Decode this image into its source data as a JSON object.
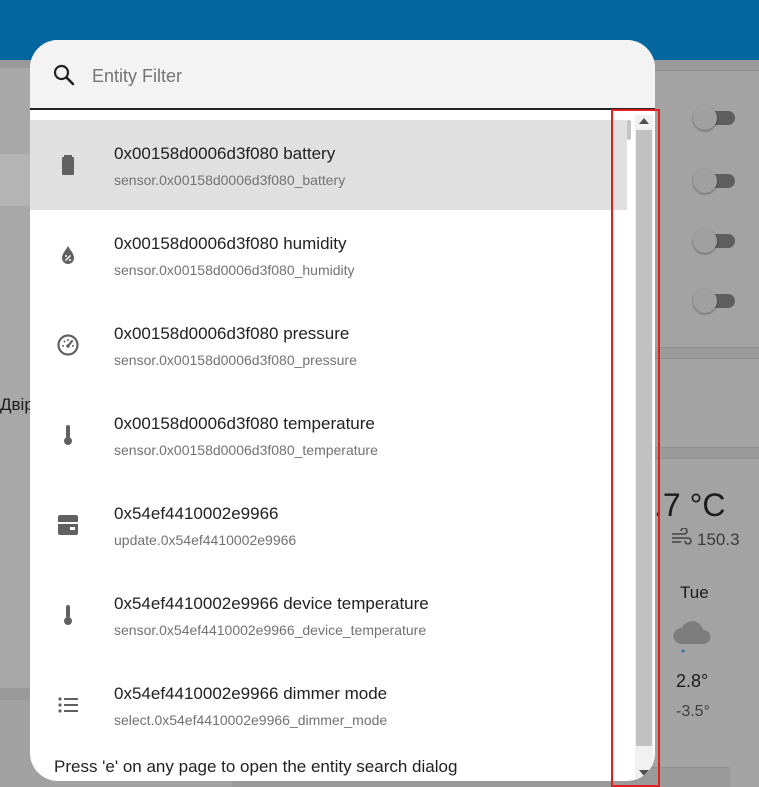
{
  "search": {
    "placeholder": "Entity Filter"
  },
  "entities": [
    {
      "name": "0x00158d0006d3f080 battery",
      "entity_id": "sensor.0x00158d0006d3f080_battery",
      "icon": "battery-icon",
      "selected": true
    },
    {
      "name": "0x00158d0006d3f080 humidity",
      "entity_id": "sensor.0x00158d0006d3f080_humidity",
      "icon": "water-percent-icon",
      "selected": false
    },
    {
      "name": "0x00158d0006d3f080 pressure",
      "entity_id": "sensor.0x00158d0006d3f080_pressure",
      "icon": "gauge-icon",
      "selected": false
    },
    {
      "name": "0x00158d0006d3f080 temperature",
      "entity_id": "sensor.0x00158d0006d3f080_temperature",
      "icon": "thermometer-icon",
      "selected": false
    },
    {
      "name": "0x54ef4410002e9966",
      "entity_id": "update.0x54ef4410002e9966",
      "icon": "package-icon",
      "selected": false
    },
    {
      "name": "0x54ef4410002e9966 device temperature",
      "entity_id": "sensor.0x54ef4410002e9966_device_temperature",
      "icon": "thermometer-icon",
      "selected": false
    },
    {
      "name": "0x54ef4410002e9966 dimmer mode",
      "entity_id": "select.0x54ef4410002e9966_dimmer_mode",
      "icon": "format-list-bulleted-icon",
      "selected": false
    }
  ],
  "footer": {
    "hint": "Press 'e' on any page to open the entity search dialog"
  },
  "background": {
    "partial_label": "Двір",
    "weather": {
      "temperature": ".7 °C",
      "wind": "150.3",
      "day": "Tue",
      "high": "2.8°",
      "low": "-3.5°"
    }
  },
  "colors": {
    "header": "#03669f",
    "selected_row": "#e0e0e0",
    "highlight": "#e02020"
  }
}
